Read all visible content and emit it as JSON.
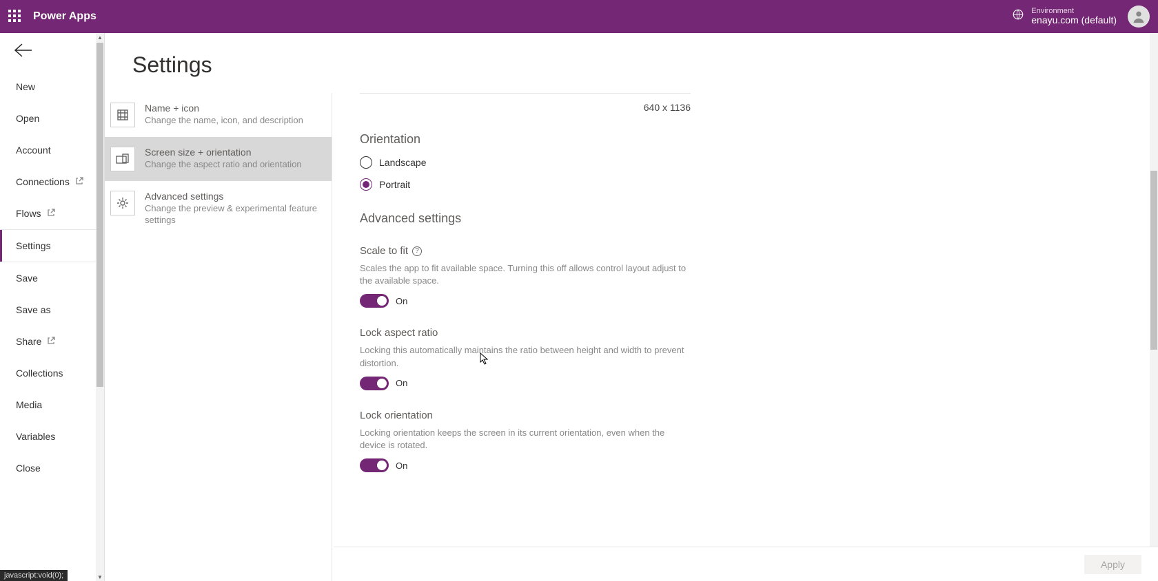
{
  "topbar": {
    "appTitle": "Power Apps",
    "envLabel": "Environment",
    "envName": "enayu.com (default)"
  },
  "sidebar": {
    "items": [
      {
        "label": "New",
        "popout": false
      },
      {
        "label": "Open",
        "popout": false
      },
      {
        "label": "Account",
        "popout": false
      },
      {
        "label": "Connections",
        "popout": true
      },
      {
        "label": "Flows",
        "popout": true
      },
      {
        "label": "Settings",
        "popout": false,
        "active": true,
        "sepBefore": true
      },
      {
        "label": "Save",
        "popout": false,
        "sepBefore": true
      },
      {
        "label": "Save as",
        "popout": false
      },
      {
        "label": "Share",
        "popout": true
      },
      {
        "label": "Collections",
        "popout": false
      },
      {
        "label": "Media",
        "popout": false
      },
      {
        "label": "Variables",
        "popout": false
      },
      {
        "label": "Close",
        "popout": false
      }
    ]
  },
  "pageTitle": "Settings",
  "categories": [
    {
      "title": "Name + icon",
      "desc": "Change the name, icon, and description",
      "selected": false
    },
    {
      "title": "Screen size + orientation",
      "desc": "Change the aspect ratio and orientation",
      "selected": true
    },
    {
      "title": "Advanced settings",
      "desc": "Change the preview & experimental feature settings",
      "selected": false
    }
  ],
  "detail": {
    "screenSize": "640 x 1136",
    "orientation": {
      "heading": "Orientation",
      "options": [
        {
          "label": "Landscape",
          "selected": false
        },
        {
          "label": "Portrait",
          "selected": true
        }
      ]
    },
    "advanced": {
      "heading": "Advanced settings",
      "settings": [
        {
          "title": "Scale to fit",
          "help": true,
          "desc": "Scales the app to fit available space. Turning this off allows control layout adjust to the available space.",
          "state": "On"
        },
        {
          "title": "Lock aspect ratio",
          "help": false,
          "desc": "Locking this automatically maintains the ratio between height and width to prevent distortion.",
          "state": "On"
        },
        {
          "title": "Lock orientation",
          "help": false,
          "desc": "Locking orientation keeps the screen in its current orientation, even when the device is rotated.",
          "state": "On"
        }
      ]
    }
  },
  "apply": "Apply",
  "statusHint": "javascript:void(0);"
}
